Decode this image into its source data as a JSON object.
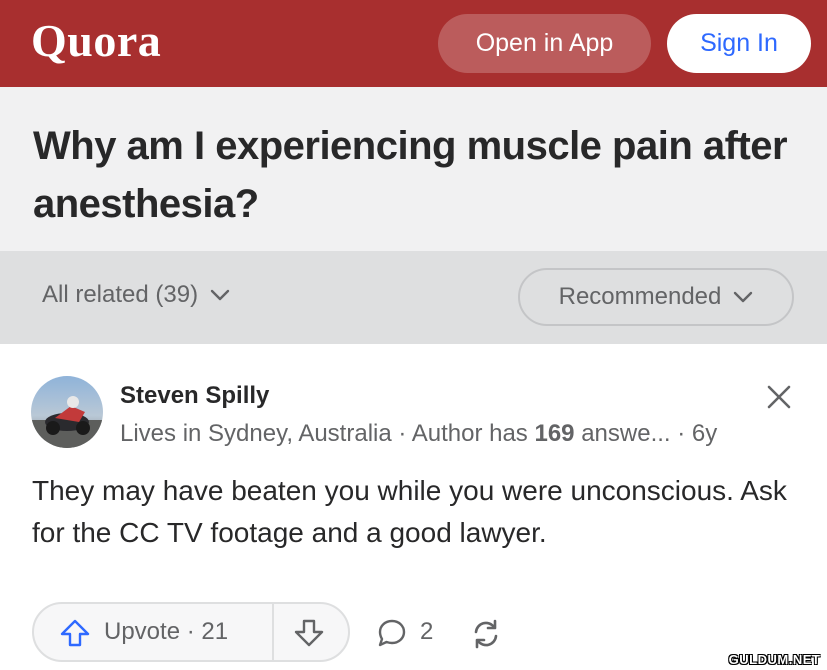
{
  "header": {
    "logo": "Quora",
    "open_in_app": "Open in App",
    "sign_in": "Sign In"
  },
  "question": {
    "title": "Why am I experiencing muscle pain after anesthesia?"
  },
  "filters": {
    "all_related": "All related (39)",
    "sort": "Recommended"
  },
  "answer": {
    "author_name": "Steven Spilly",
    "author_location": "Lives in Sydney, Australia",
    "author_has_prefix": "Author has",
    "answer_count": "169",
    "answers_suffix": "answe...",
    "age": "6y",
    "text": "They may have beaten you while you were unconscious. Ask for the CC TV footage and a good lawyer.",
    "upvote_label": "Upvote",
    "upvote_count": "21",
    "comment_count": "2"
  },
  "watermark": "GULDUM.NET",
  "colors": {
    "brand": "#a82f2f",
    "link_blue": "#2e69ff",
    "upvote_blue": "#2e69ff"
  },
  "icons": [
    "chevron-down-icon",
    "close-icon",
    "upvote-arrow-icon",
    "downvote-arrow-icon",
    "comment-icon",
    "share-icon"
  ]
}
